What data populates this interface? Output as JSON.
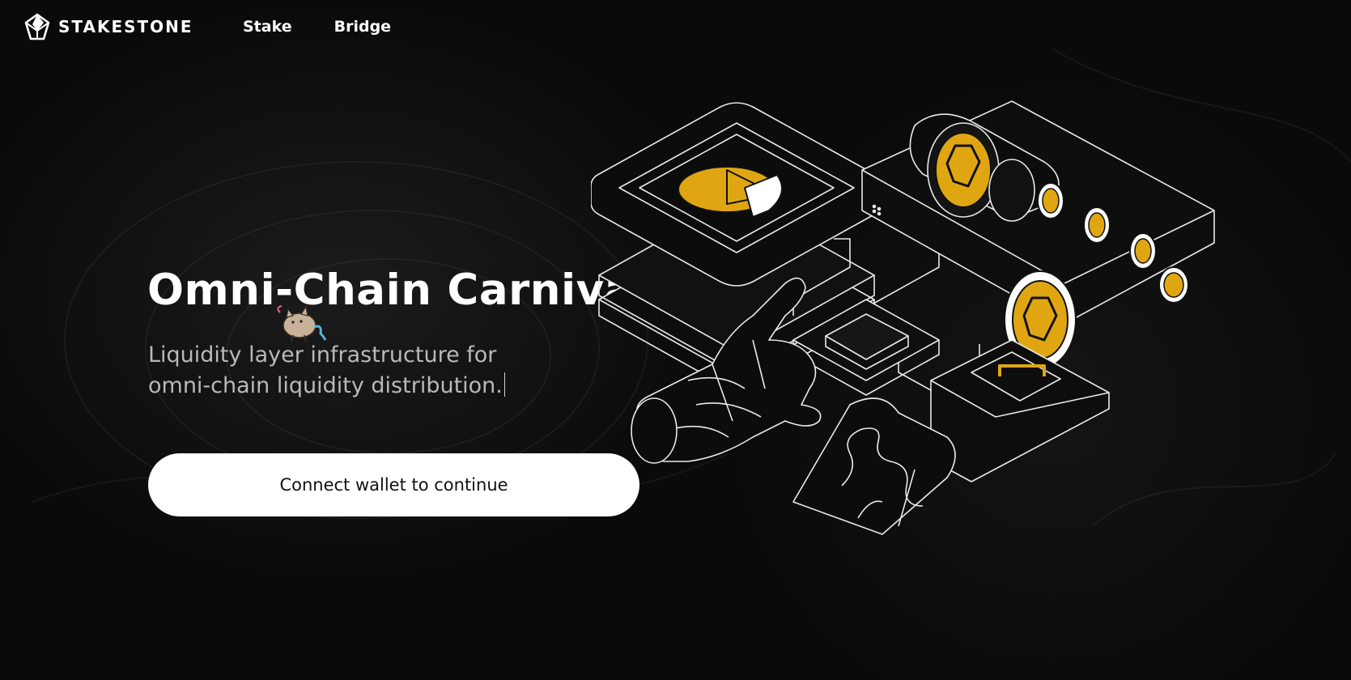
{
  "brand": {
    "name": "STAKESTONE",
    "logo_icon": "stakestone-gem-icon"
  },
  "nav": {
    "items": [
      {
        "label": "Stake"
      },
      {
        "label": "Bridge"
      }
    ]
  },
  "hero": {
    "title": "Omni-Chain Carnival",
    "subtitle_line1": "Liquidity layer infrastructure for",
    "subtitle_line2": "omni-chain liquidity distribution.",
    "cta_label": "Connect wallet to continue"
  },
  "colors": {
    "background": "#0a0a0a",
    "accent": "#e0a612",
    "text": "#ffffff",
    "subtitle": "#b9b9b9",
    "button_bg": "#ffffff",
    "button_text": "#111111"
  },
  "decorations": {
    "cursor_sticker": "cat-sticker-icon",
    "hero_illustration": "isometric-staking-machine-illustration"
  }
}
